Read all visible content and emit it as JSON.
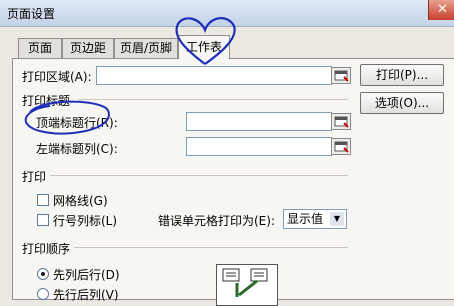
{
  "window": {
    "title": "页面设置"
  },
  "tabs": [
    {
      "label": "页面"
    },
    {
      "label": "页边距"
    },
    {
      "label": "页眉/页脚"
    },
    {
      "label": "工作表"
    }
  ],
  "print_area": {
    "label": "打印区域(A):",
    "value": ""
  },
  "print_titles": {
    "heading": "打印标题",
    "top_rows_label": "顶端标题行(R):",
    "top_rows_value": "",
    "left_cols_label": "左端标题列(C):",
    "left_cols_value": ""
  },
  "print": {
    "heading": "打印",
    "gridlines_label": "网格线(G)",
    "row_col_headings_label": "行号列标(L)",
    "cell_errors_label": "错误单元格打印为(E):",
    "cell_errors_value": "显示值"
  },
  "page_order": {
    "heading": "打印顺序",
    "down_then_over": "先列后行(D)",
    "over_then_down": "先行后列(V)"
  },
  "buttons": {
    "print": "打印(P)...",
    "options": "选项(O)..."
  }
}
